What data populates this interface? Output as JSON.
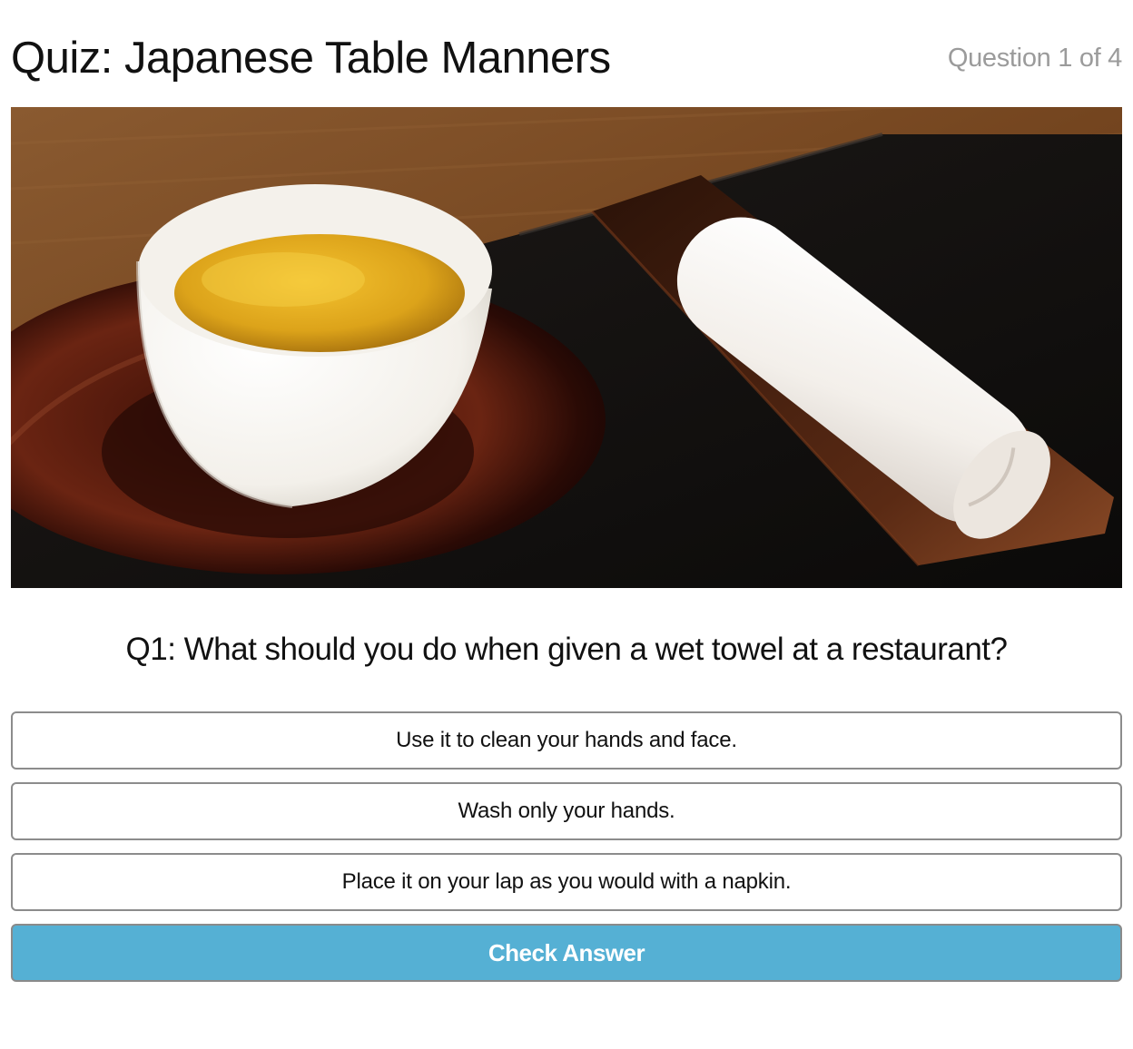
{
  "header": {
    "title": "Quiz: Japanese Table Manners",
    "progress": "Question 1 of 4"
  },
  "hero_image": {
    "icon": "photo-tea-cup-and-oshibori-towel"
  },
  "question": {
    "text": "Q1: What should you do when given a wet towel at a restaurant?"
  },
  "answers": [
    {
      "label": "Use it to clean your hands and face."
    },
    {
      "label": "Wash only your hands."
    },
    {
      "label": "Place it on your lap as you would with a napkin."
    }
  ],
  "actions": {
    "check_label": "Check Answer"
  },
  "colors": {
    "check_button_bg": "#55b0d4",
    "answer_border": "#8c8c8c",
    "progress_text": "#9b9b9b"
  }
}
